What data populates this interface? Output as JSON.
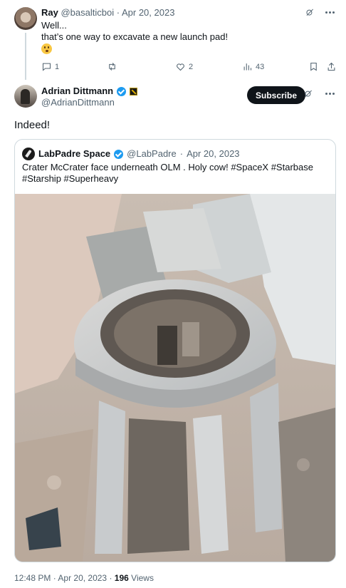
{
  "reply": {
    "name": "Ray",
    "handle": "@basalticboi",
    "separator": "·",
    "date": "Apr 20, 2023",
    "line1": "Well...",
    "line2": "that’s one way to excavate a new launch pad!",
    "emoji": "😮",
    "replies": "1",
    "retweets": "",
    "likes": "2",
    "views": "43"
  },
  "main": {
    "name": "Adrian Dittmann",
    "handle": "@AdrianDittmann",
    "subscribe_label": "Subscribe",
    "text": "Indeed!"
  },
  "quote": {
    "name": "LabPadre Space",
    "handle": "@LabPadre",
    "separator": "·",
    "date": "Apr 20, 2023",
    "text": "Crater McCrater face underneath OLM . Holy cow! #SpaceX #Starbase #Starship #Superheavy"
  },
  "footer": {
    "time": "12:48 PM",
    "separator": "·",
    "date": "Apr 20, 2023",
    "dot": "·",
    "views_count": "196",
    "views_label": "Views"
  },
  "colors": {
    "text": "#0f1419",
    "muted": "#536471",
    "border": "#cfd9de",
    "verified": "#1d9bf0",
    "subscribe_bg": "#0f1419"
  },
  "icons": [
    "grok-icon",
    "more-icon",
    "reply-icon",
    "retweet-icon",
    "like-icon",
    "views-icon",
    "bookmark-icon",
    "share-icon",
    "verified-icon",
    "affiliate-badge-icon"
  ]
}
